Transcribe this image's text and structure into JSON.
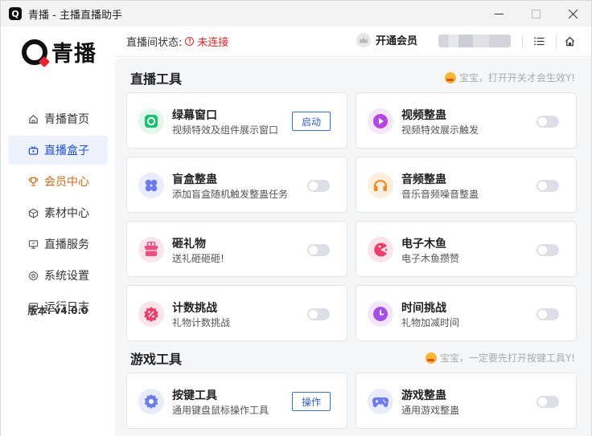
{
  "window": {
    "title": "青播 - 主播直播助手",
    "app_icon_letter": "Q"
  },
  "sidebar": {
    "logo_text": "青播",
    "items": [
      {
        "label": "青播首页",
        "icon": "home-icon",
        "active": false
      },
      {
        "label": "直播盒子",
        "icon": "live-box-icon",
        "active": true
      },
      {
        "label": "会员中心",
        "icon": "trophy-icon",
        "active": false
      },
      {
        "label": "素材中心",
        "icon": "cube-icon",
        "active": false
      },
      {
        "label": "直播服务",
        "icon": "monitor-icon",
        "active": false
      },
      {
        "label": "系统设置",
        "icon": "gear-icon",
        "active": false
      },
      {
        "label": "运行日志",
        "icon": "log-icon",
        "active": false
      }
    ],
    "version": "版本: v4.0.0"
  },
  "header": {
    "status_label": "直播间状态:",
    "status_value": "未连接",
    "vip_label": "开通会员"
  },
  "sections": [
    {
      "title": "直播工具",
      "hint": "宝宝，打开开关才会生效Y!",
      "cards": [
        {
          "title": "绿幕窗口",
          "desc": "视频特效及组件展示窗口",
          "control": "button",
          "button_label": "启动",
          "icon": "green-screen-icon",
          "icon_color": "#16c172",
          "icon_bg": "#e3f7ec"
        },
        {
          "title": "视频整蛊",
          "desc": "视频特效展示触发",
          "control": "toggle",
          "icon": "video-play-icon",
          "icon_color": "#b545e0",
          "icon_bg": "#f5e6fb"
        },
        {
          "title": "盲盒整蛊",
          "desc": "添加盲盒随机触发整蛊任务",
          "control": "toggle",
          "icon": "clover-icon",
          "icon_color": "#6c7cf0",
          "icon_bg": "#e9ecfd"
        },
        {
          "title": "音频整蛊",
          "desc": "音乐音频噪音整蛊",
          "control": "toggle",
          "icon": "headphones-icon",
          "icon_color": "#f08a24",
          "icon_bg": "#fdeedd"
        },
        {
          "title": "砸礼物",
          "desc": "送礼砸砸砸!",
          "control": "toggle",
          "icon": "gift-icon",
          "icon_color": "#ef4f7f",
          "icon_bg": "#fde4ec"
        },
        {
          "title": "电子木鱼",
          "desc": "电子木鱼攒赞",
          "control": "toggle",
          "icon": "pacman-icon",
          "icon_color": "#ee3f6c",
          "icon_bg": "#fde4ea"
        },
        {
          "title": "计数挑战",
          "desc": "礼物计数挑战",
          "control": "toggle",
          "icon": "percent-badge-icon",
          "icon_color": "#ee3f6c",
          "icon_bg": "#fde4ea"
        },
        {
          "title": "时间挑战",
          "desc": "礼物加减时间",
          "control": "toggle",
          "icon": "clock-icon",
          "icon_color": "#a550e0",
          "icon_bg": "#f3e6fc"
        }
      ]
    },
    {
      "title": "游戏工具",
      "hint": "宝宝，一定要先打开按键工具Y!",
      "cards": [
        {
          "title": "按键工具",
          "desc": "通用键盘鼠标操作工具",
          "control": "button",
          "button_label": "操作",
          "icon": "gear-badge-icon",
          "icon_color": "#6c7cf0",
          "icon_bg": "#e9ecfd"
        },
        {
          "title": "游戏整蛊",
          "desc": "通用游戏整蛊",
          "control": "toggle",
          "icon": "gamepad-icon",
          "icon_color": "#6c7cf0",
          "icon_bg": "#e9ecfd"
        }
      ]
    }
  ],
  "colors": {
    "accent": "#1e4ed8",
    "danger": "#e02424",
    "vip": "#c86b16"
  }
}
